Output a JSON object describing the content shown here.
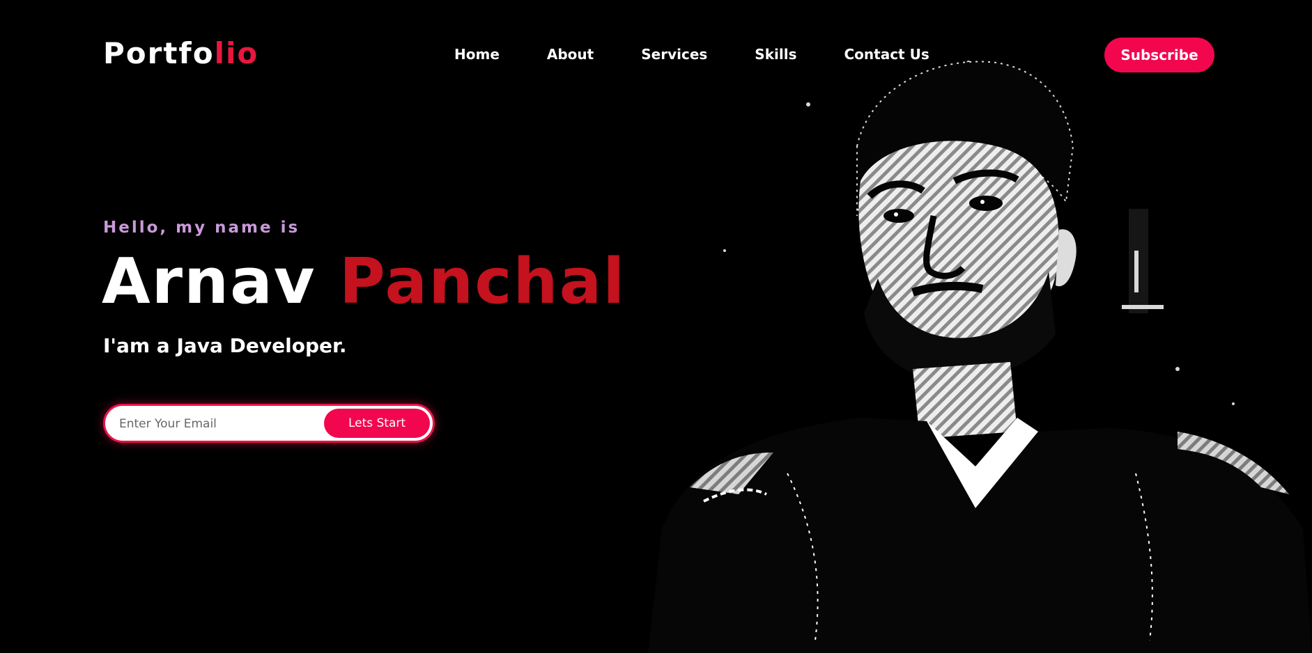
{
  "header": {
    "logo_main": "Portfo",
    "logo_accent": "lio",
    "nav": [
      "Home",
      "About",
      "Services",
      "Skills",
      "Contact Us"
    ],
    "subscribe_label": "Subscribe"
  },
  "hero": {
    "greeting": "Hello, my name is",
    "first_name": "Arnav",
    "last_name": "Panchal",
    "role": "I'am a Java Developer."
  },
  "form": {
    "email_placeholder": "Enter Your Email",
    "email_value": "",
    "start_label": "Lets Start"
  },
  "colors": {
    "accent_pink": "#f2074f",
    "name_red": "#c4121e",
    "greeting_lilac": "#c99ad8",
    "background": "#000000"
  },
  "icons": {
    "portrait": "profile-photo-stylized"
  }
}
